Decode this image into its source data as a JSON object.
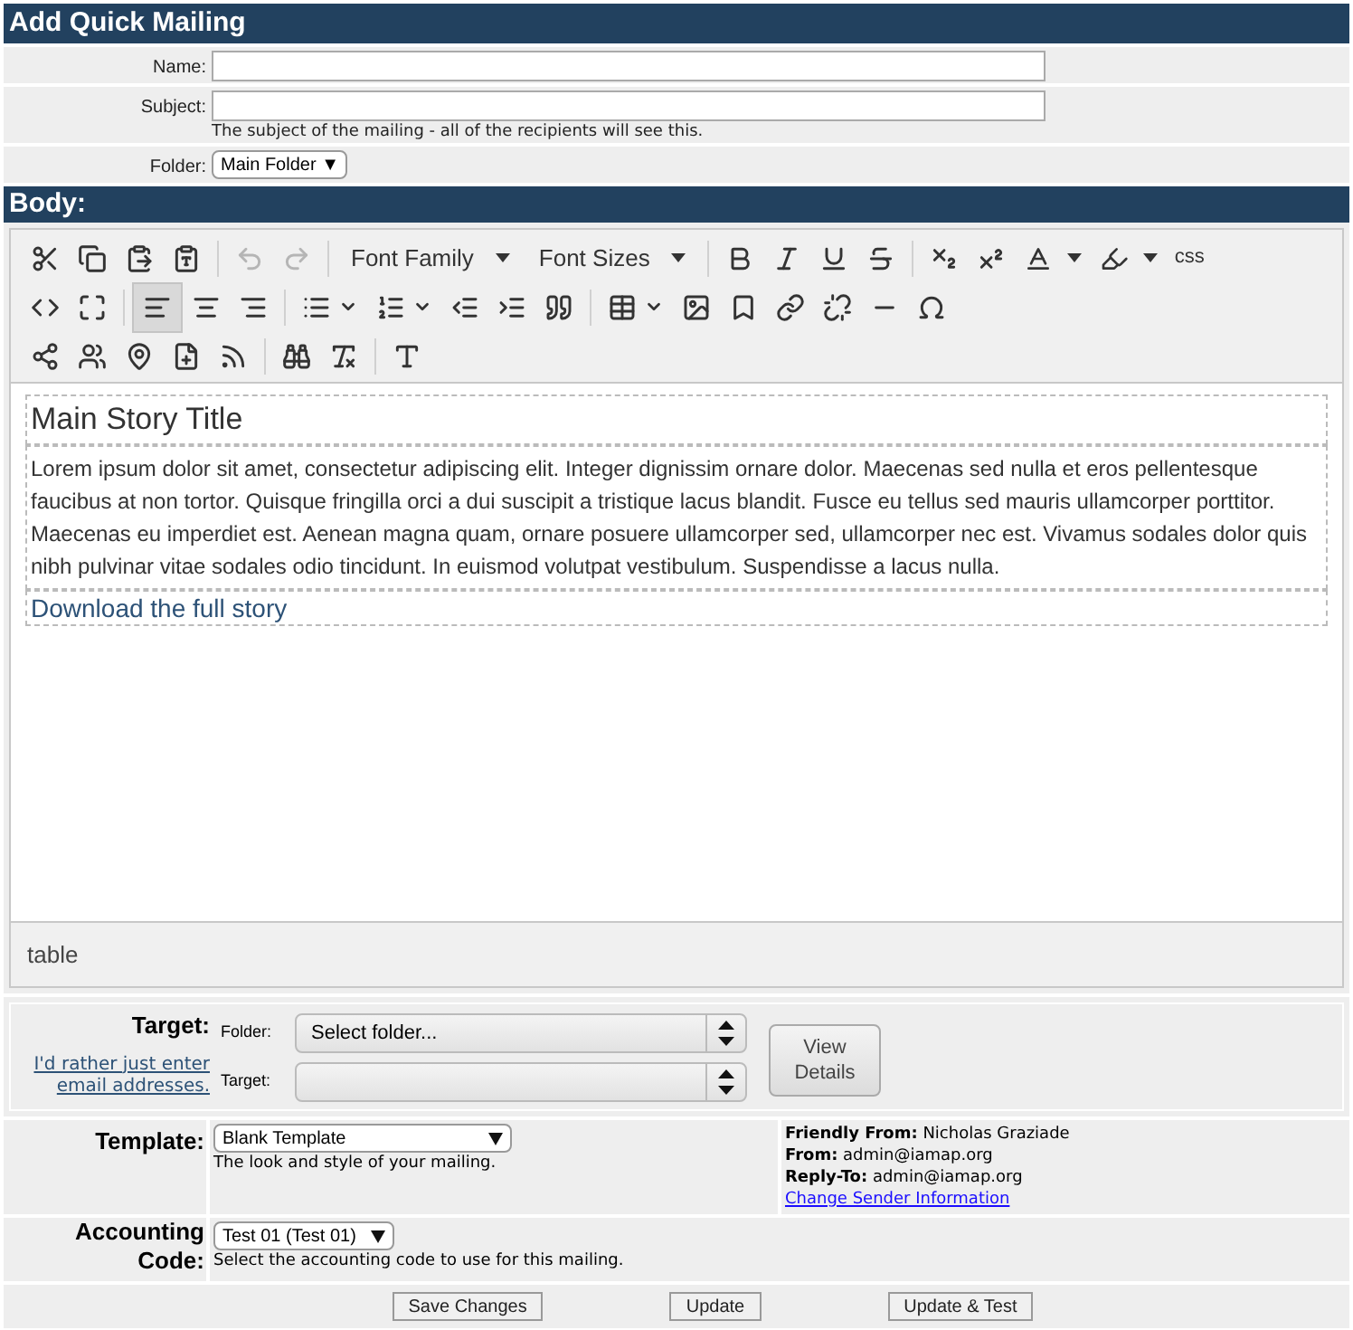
{
  "title": "Add Quick Mailing",
  "fields": {
    "name": {
      "label": "Name:"
    },
    "subject": {
      "label": "Subject:",
      "help": "The subject of the mailing - all of the recipients will see this."
    },
    "folder": {
      "label": "Folder:",
      "value": "Main Folder ▼"
    }
  },
  "body": {
    "title": "Body:",
    "toolbar": {
      "font_family": "Font Family",
      "font_sizes": "Font Sizes",
      "css": "css",
      "undo": {
        "disabled": true
      },
      "redo": {
        "disabled": true
      },
      "align_left": {
        "selected": true
      },
      "align_center": {
        "selected": false
      },
      "align_right": {
        "selected": false
      }
    },
    "content": {
      "heading": "Main Story Title",
      "paragraph": "Lorem ipsum dolor sit amet, consectetur adipiscing elit. Integer dignissim ornare dolor. Maecenas sed nulla et eros pellentesque faucibus at non tortor. Quisque fringilla orci a dui suscipit a tristique lacus blandit. Fusce eu tellus sed mauris ullamcorper porttitor. Maecenas eu imperdiet est. Aenean magna quam, ornare posuere ullamcorper sed, ullamcorper nec est. Vivamus sodales dolor quis nibh pulvinar vitae sodales odio tincidunt. In euismod volutpat vestibulum. Suspendisse a lacus nulla.",
      "link": "Download the full story"
    },
    "status": "table"
  },
  "target": {
    "label": "Target:",
    "alt_link": "I'd rather just enter email addresses.",
    "folder_label": "Folder:",
    "folder_value": "Select folder...",
    "target_label": "Target:",
    "button": "View Details"
  },
  "template": {
    "label": "Template:",
    "value": "Blank Template",
    "help": "The look and style of your mailing.",
    "sender": [
      {
        "key": "Friendly From:",
        "value": "Nicholas Graziade"
      },
      {
        "key": "From:",
        "value": "admin@iamap.org"
      },
      {
        "key": "Reply-To:",
        "value": "admin@iamap.org"
      }
    ],
    "change_link": "Change Sender Information"
  },
  "accounting": {
    "label": "Accounting Code:",
    "value": "Test 01 (Test 01)",
    "help": "Select the accounting code to use for this mailing."
  },
  "buttons": [
    "Save Changes",
    "Update",
    "Update & Test"
  ]
}
